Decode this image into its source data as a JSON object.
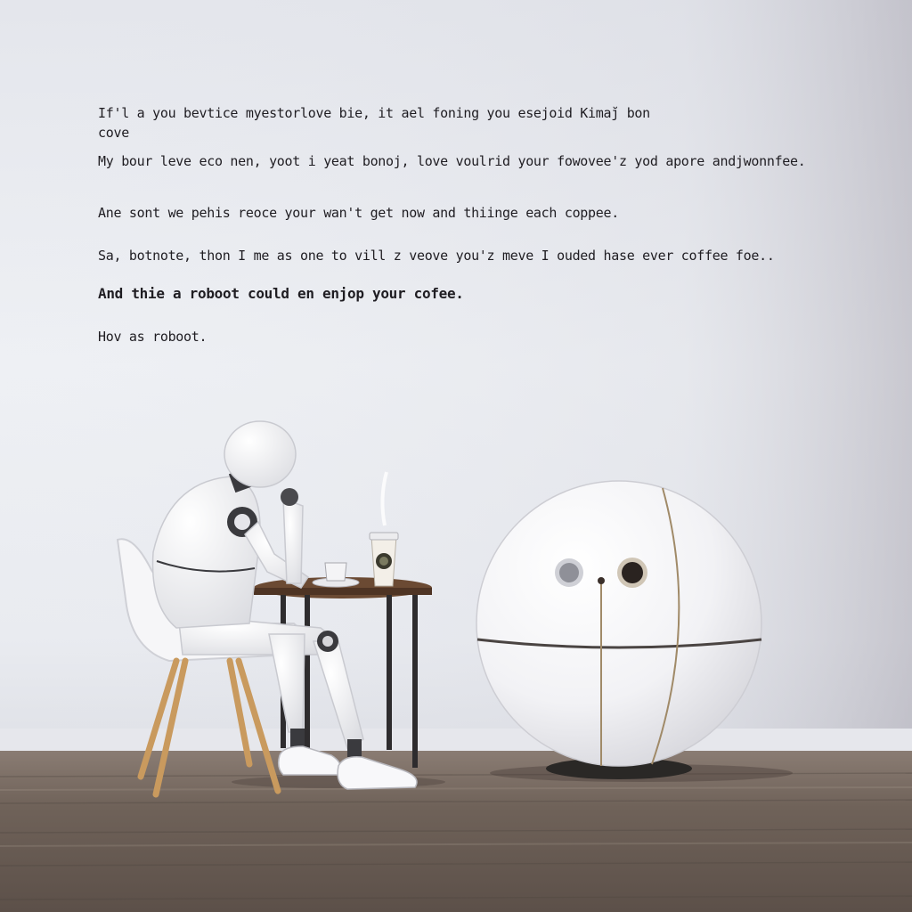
{
  "caption": {
    "lines": [
      "If'l a you bevtice myestorlove bie, it ael  foning you esejoid Kimaj̆ bon",
      "cove",
      "My bour leve eco nen,  yoot i yeat bonoj, love voulrid your fowovee'z yod apore andjwonnfee.",
      "Ane sont  we pehis reoce your wan't get  now and thiinge each coppee.",
      "Sa, botnote, thon I me as one to vill z veove you'z  meve I ouded hase ever coffee foe..",
      "And thie a roboot could en enjop your cofee.",
      "Hov as roboot."
    ]
  },
  "scene": {
    "wall_color": "#eceef2",
    "floor_color": "#6e6058",
    "robot_color": "#f4f4f6",
    "sphere_color": "#f7f7f9",
    "table_top_color": "#6b4a33",
    "chair_leg_color": "#c99a5e",
    "objects": [
      "humanoid-robot",
      "white-chair",
      "round-side-table",
      "coffee-cup-with-saucer",
      "takeaway-coffee-cup",
      "sphere-robot"
    ]
  }
}
